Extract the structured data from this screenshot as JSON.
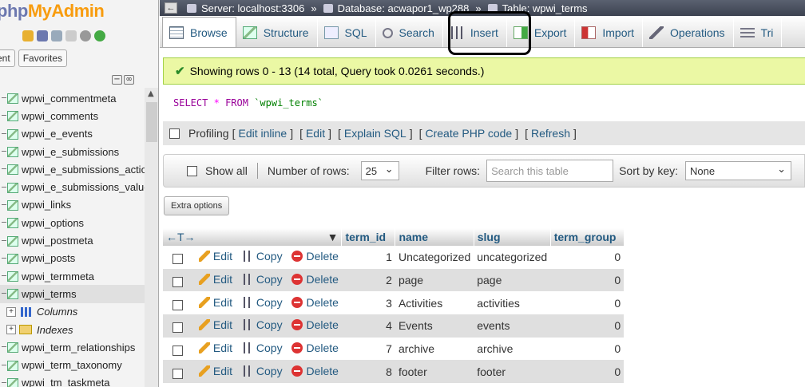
{
  "sidebar": {
    "logo_part1": "php",
    "logo_part2": "MyAdmin",
    "tab_recent": "ent",
    "tab_favorites": "Favorites",
    "tables": [
      {
        "label": "wpwi_commentmeta"
      },
      {
        "label": "wpwi_comments"
      },
      {
        "label": "wpwi_e_events"
      },
      {
        "label": "wpwi_e_submissions"
      },
      {
        "label": "wpwi_e_submissions_actio"
      },
      {
        "label": "wpwi_e_submissions_value"
      },
      {
        "label": "wpwi_links"
      },
      {
        "label": "wpwi_options"
      },
      {
        "label": "wpwi_postmeta"
      },
      {
        "label": "wpwi_posts"
      },
      {
        "label": "wpwi_termmeta"
      },
      {
        "label": "wpwi_terms"
      }
    ],
    "sub_columns": "Columns",
    "sub_indexes": "Indexes",
    "tables_after": [
      {
        "label": "wpwi_term_relationships"
      },
      {
        "label": "wpwi_term_taxonomy"
      },
      {
        "label": "wpwi_tm_taskmeta"
      }
    ]
  },
  "breadcrumb": {
    "server": "Server: localhost:3306",
    "database": "Database: acwapor1_wp288",
    "table": "Table: wpwi_terms",
    "sep": "»"
  },
  "tabs": [
    {
      "label": "Browse"
    },
    {
      "label": "Structure"
    },
    {
      "label": "SQL"
    },
    {
      "label": "Search"
    },
    {
      "label": "Insert"
    },
    {
      "label": "Export"
    },
    {
      "label": "Import"
    },
    {
      "label": "Operations"
    },
    {
      "label": "Tri"
    }
  ],
  "success_message": "Showing rows 0 - 13 (14 total, Query took 0.0261 seconds.)",
  "sql": {
    "select": "SELECT",
    "star": "*",
    "from": "FROM",
    "table": "`wpwi_terms`"
  },
  "links": {
    "profiling": "Profiling",
    "edit_inline": "Edit inline",
    "edit": "Edit",
    "explain": "Explain SQL",
    "php": "Create PHP code",
    "refresh": "Refresh",
    "lb": "[",
    "rb": "]"
  },
  "nav": {
    "show_all": "Show all",
    "num_rows_label": "Number of rows:",
    "num_rows_value": "25",
    "filter_label": "Filter rows:",
    "filter_placeholder": "Search this table",
    "sort_label": "Sort by key:",
    "sort_value": "None"
  },
  "extra_options": "Extra options",
  "table": {
    "columns": [
      "term_id",
      "name",
      "slug",
      "term_group"
    ],
    "actions": {
      "edit": "Edit",
      "copy": "Copy",
      "delete": "Delete"
    },
    "rows": [
      {
        "term_id": "1",
        "name": "Uncategorized",
        "slug": "uncategorized",
        "term_group": "0"
      },
      {
        "term_id": "2",
        "name": "page",
        "slug": "page",
        "term_group": "0"
      },
      {
        "term_id": "3",
        "name": "Activities",
        "slug": "activities",
        "term_group": "0"
      },
      {
        "term_id": "4",
        "name": "Events",
        "slug": "events",
        "term_group": "0"
      },
      {
        "term_id": "7",
        "name": "archive",
        "slug": "archive",
        "term_group": "0"
      },
      {
        "term_id": "8",
        "name": "footer",
        "slug": "footer",
        "term_group": "0"
      }
    ]
  },
  "colors": {
    "link": "#235a81",
    "success_bg": "#ebf8a4",
    "logo_blue": "#6c78af",
    "logo_orange": "#f89c0e"
  }
}
